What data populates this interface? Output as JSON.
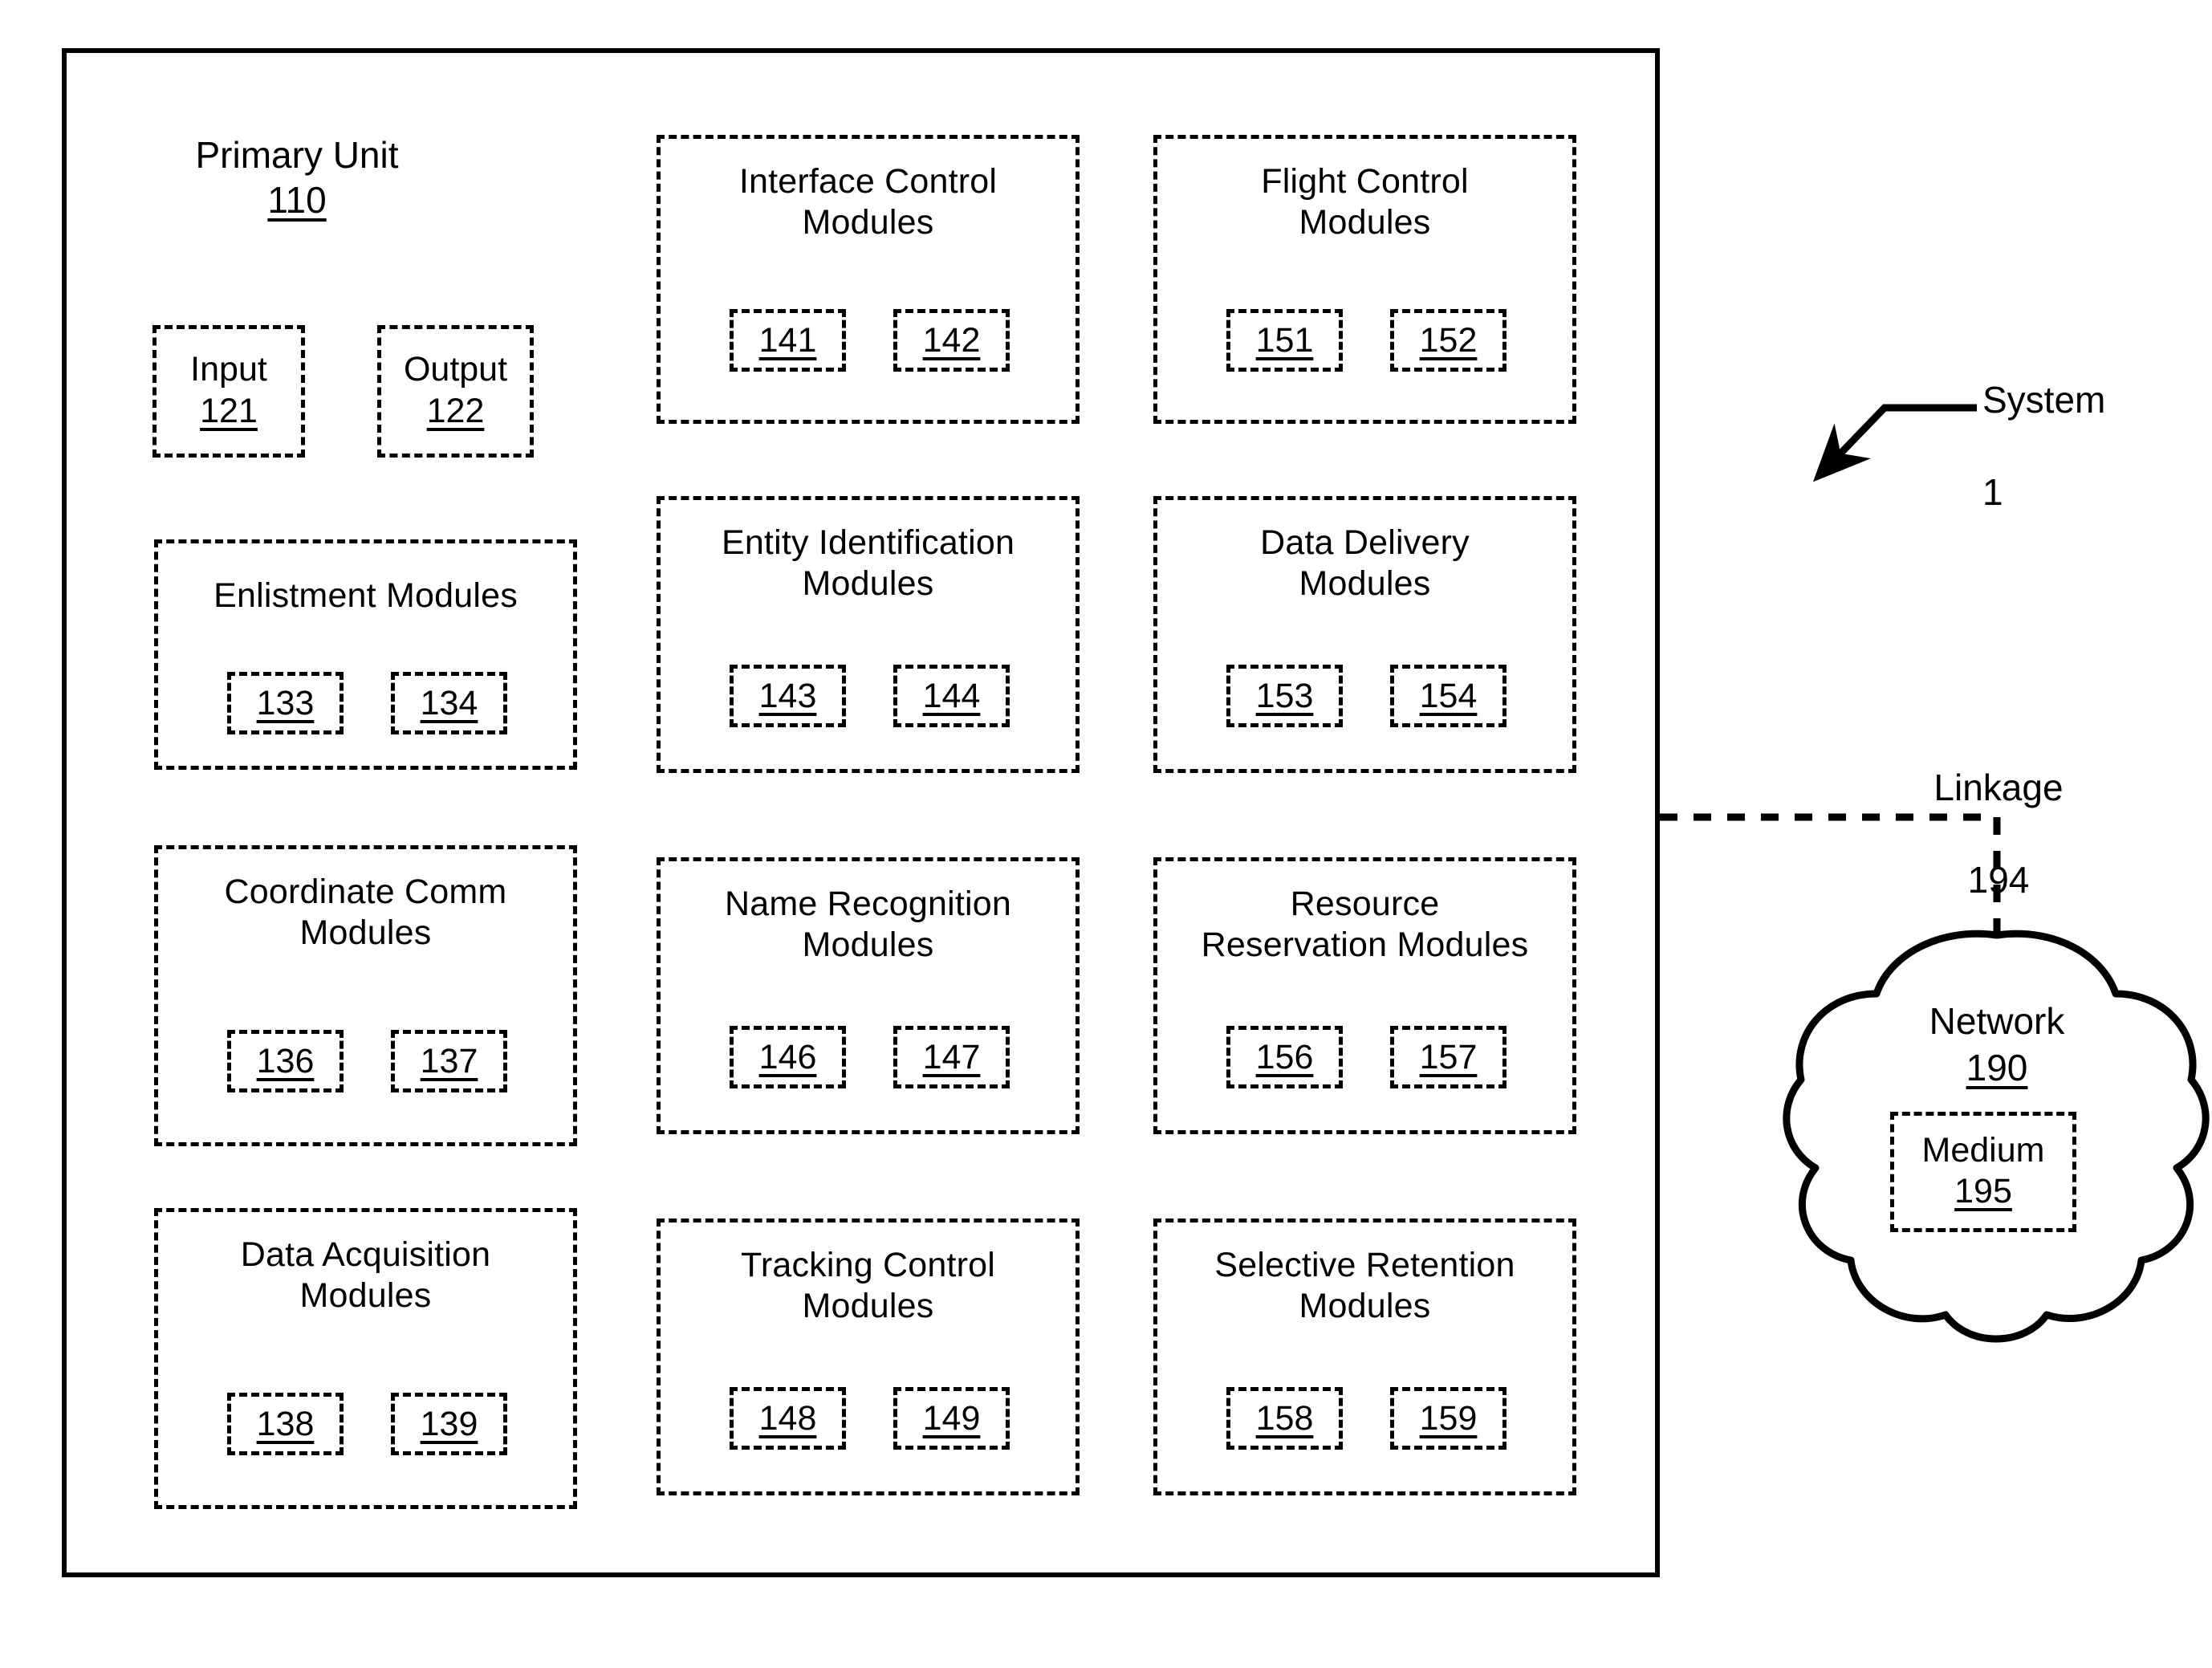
{
  "figure": {
    "primary_unit": {
      "label": "Primary Unit",
      "ref": "110"
    },
    "io_boxes": [
      {
        "label": "Input",
        "ref": "121"
      },
      {
        "label": "Output",
        "ref": "122"
      }
    ],
    "module_groups": [
      {
        "title": "Enlistment Modules",
        "refs": [
          "133",
          "134"
        ]
      },
      {
        "title": "Coordinate Comm\nModules",
        "refs": [
          "136",
          "137"
        ]
      },
      {
        "title": "Data Acquisition\nModules",
        "refs": [
          "138",
          "139"
        ]
      },
      {
        "title": "Interface Control\nModules",
        "refs": [
          "141",
          "142"
        ]
      },
      {
        "title": "Entity Identification\nModules",
        "refs": [
          "143",
          "144"
        ]
      },
      {
        "title": "Name Recognition\nModules",
        "refs": [
          "146",
          "147"
        ]
      },
      {
        "title": "Tracking Control\nModules",
        "refs": [
          "148",
          "149"
        ]
      },
      {
        "title": "Flight Control\nModules",
        "refs": [
          "151",
          "152"
        ]
      },
      {
        "title": "Data Delivery\nModules",
        "refs": [
          "153",
          "154"
        ]
      },
      {
        "title": "Resource\nReservation Modules",
        "refs": [
          "156",
          "157"
        ]
      },
      {
        "title": "Selective Retention\nModules",
        "refs": [
          "158",
          "159"
        ]
      }
    ],
    "annotations": {
      "system_label": "System",
      "system_ref": "1",
      "linkage_label": "Linkage",
      "linkage_ref": "194"
    },
    "network": {
      "label": "Network",
      "ref": "190",
      "medium_label": "Medium",
      "medium_ref": "195"
    },
    "colors": {
      "stroke": "#000000",
      "background": "#ffffff"
    }
  }
}
